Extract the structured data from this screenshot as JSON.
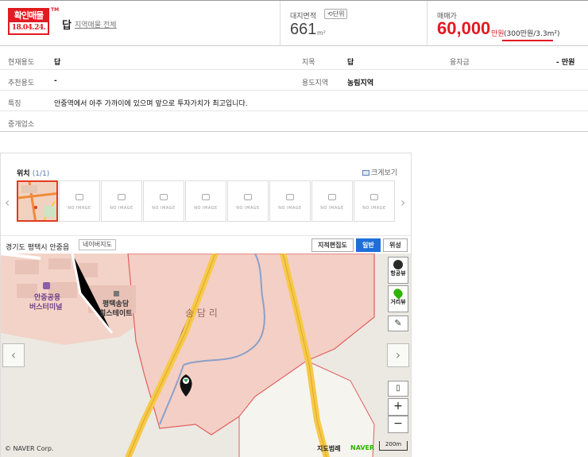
{
  "header": {
    "verify_badge_top": "확인매물",
    "verify_badge_date": "18.04.24.",
    "verify_badge_tm": "TM",
    "property_type": "답",
    "region_all_link": "지역매물 전체",
    "area_label": "대지면적",
    "unit_button": "단위",
    "area_value": "661",
    "area_unit": "m²",
    "price_label": "매매가",
    "price_value": "60,000",
    "price_unit": "만원",
    "price_per_area": "(300만원/3.3m²)"
  },
  "info": {
    "current_use_label": "현재용도",
    "current_use_value": "답",
    "land_category_label": "지목",
    "land_category_value": "답",
    "loan_label": "융자금",
    "loan_value": "- 만원",
    "recommended_use_label": "추천용도",
    "recommended_use_value": "-",
    "zoning_label": "용도지역",
    "zoning_value": "농림지역",
    "feature_label": "특징",
    "feature_value": "안중역에서 아주 가까이에 있으며 앞으로 투자가치가 최고입니다.",
    "agent_label": "중개업소",
    "agent_value": ""
  },
  "location": {
    "title": "위치",
    "count": "(1/1)",
    "big_view": "크게보기",
    "no_image": "NO IMAGE",
    "address": "경기도 평택시 안중읍",
    "naver_map_button": "네이버지도",
    "map_types": [
      "지적편집도",
      "일반",
      "위성"
    ],
    "active_map_type": "일반"
  },
  "map": {
    "labels": {
      "bus_terminal_1": "안중공용",
      "bus_terminal_2": "버스터미널",
      "apartment_1": "평택송담",
      "apartment_2": "힐스테이트",
      "village": "송 담 리"
    },
    "aerial_view": "항공뷰",
    "street_view": "거리뷰",
    "zoom_in": "+",
    "zoom_out": "−",
    "copyright": "© NAVER Corp.",
    "map_data": "지도범례",
    "naver_logo": "NAVER",
    "scale": "200m"
  },
  "colors": {
    "accent_red": "#e21a22",
    "map_active_blue": "#1e6fd9",
    "parcel_fill": "#f4cfc5",
    "road_yellow": "#f6c948"
  }
}
